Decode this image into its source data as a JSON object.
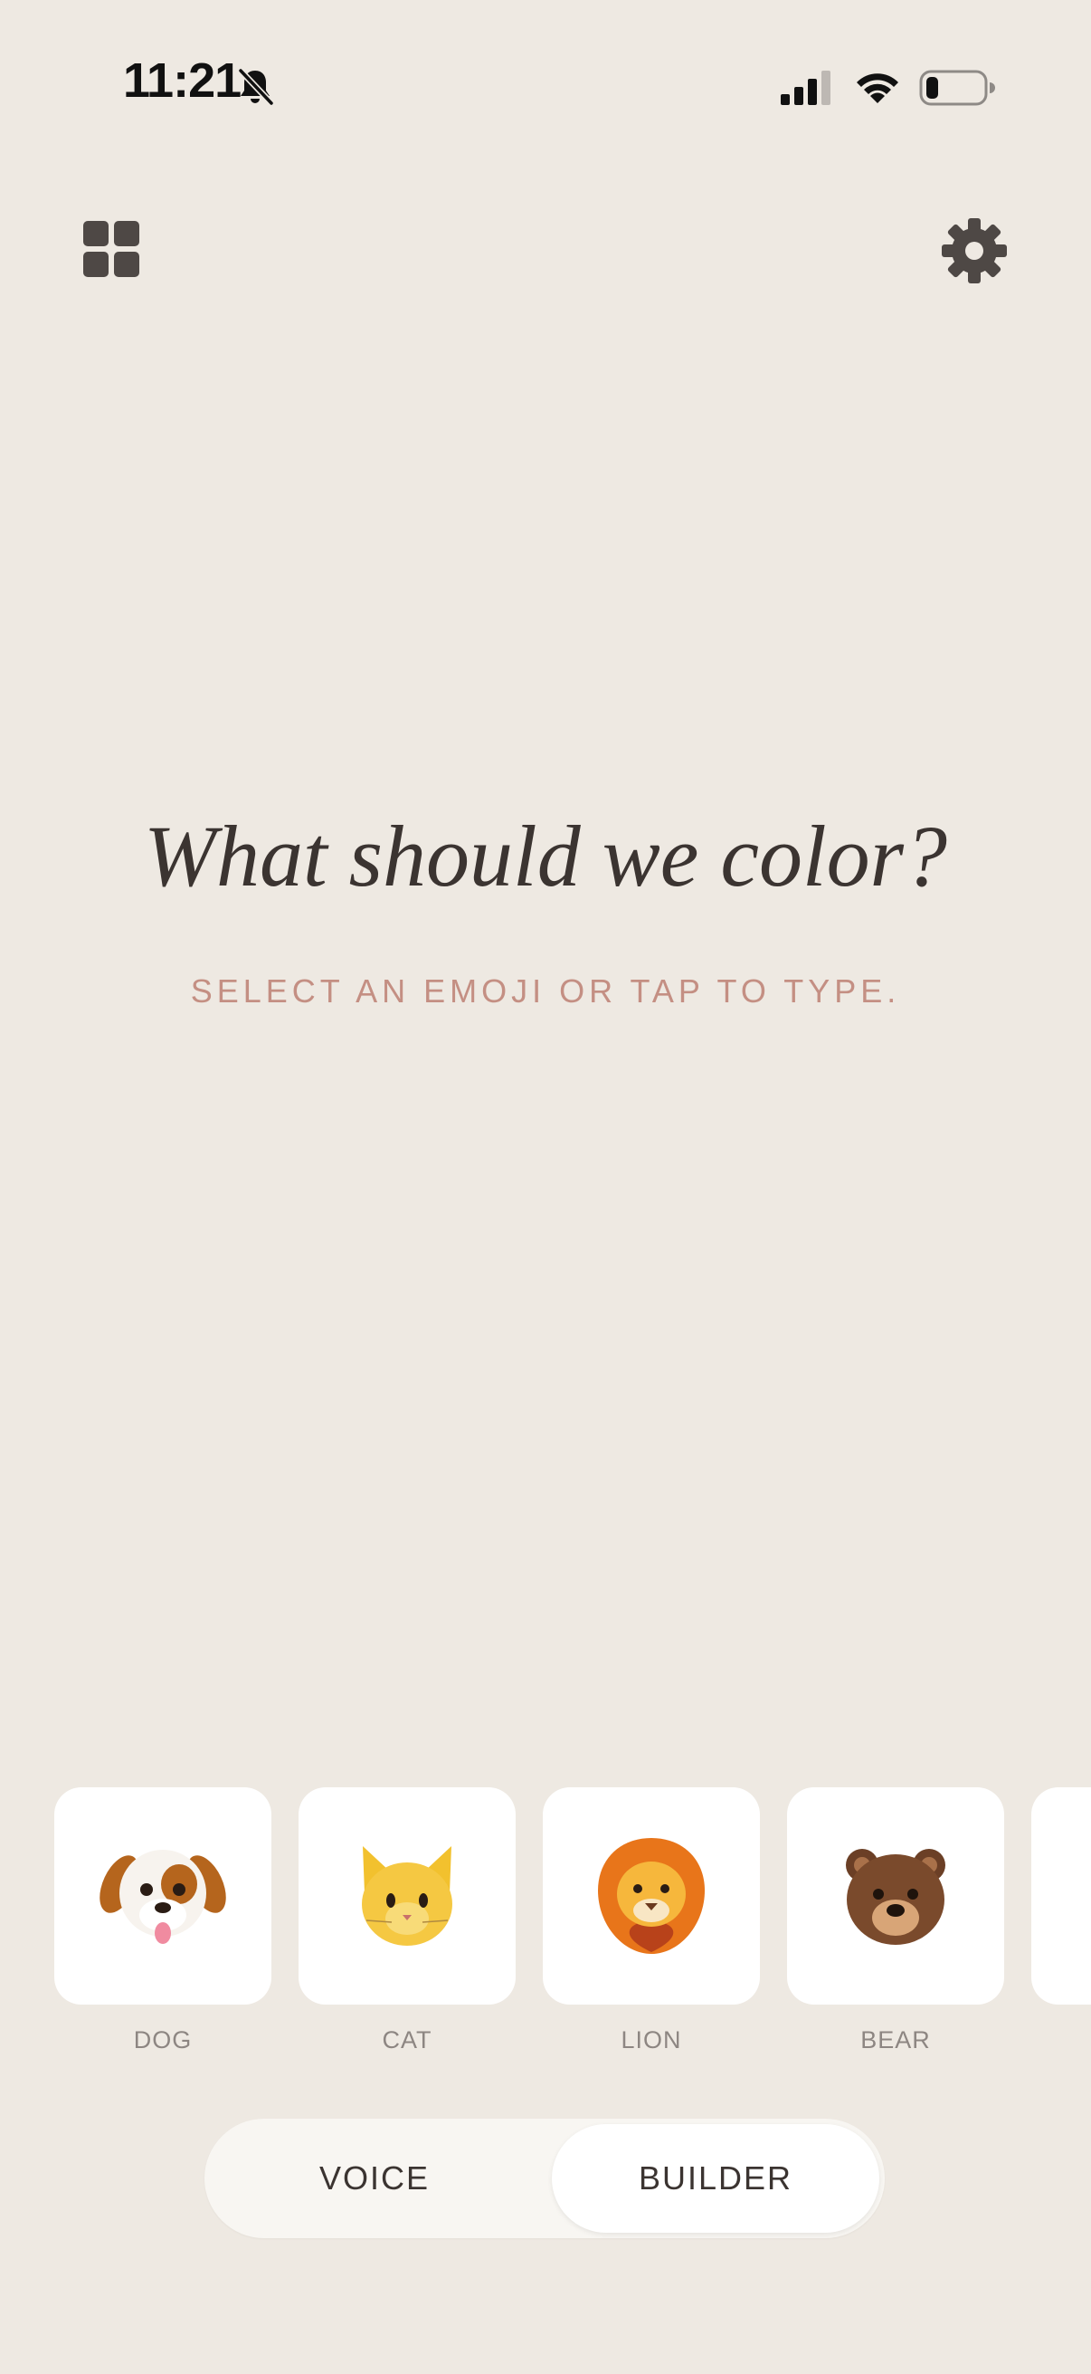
{
  "status_bar": {
    "time": "11:21",
    "icons": [
      "bell-slash-icon",
      "cellular-signal-icon",
      "wifi-icon",
      "battery-icon"
    ]
  },
  "header": {
    "left_icon": "grid-icon",
    "right_icon": "gear-icon"
  },
  "main": {
    "title": "What should we color?",
    "subtitle": "SELECT AN EMOJI OR TAP TO TYPE."
  },
  "emojis": [
    {
      "label": "DOG",
      "icon": "dog-face-icon"
    },
    {
      "label": "CAT",
      "icon": "cat-face-icon"
    },
    {
      "label": "LION",
      "icon": "lion-face-icon"
    },
    {
      "label": "BEAR",
      "icon": "bear-face-icon"
    }
  ],
  "mode_switch": {
    "options": [
      "VOICE",
      "BUILDER"
    ],
    "selected": "BUILDER"
  },
  "colors": {
    "background": "#EEE9E2",
    "title": "#3B3431",
    "subtitle_accent": "#C48F83",
    "icon": "#4E4845"
  }
}
